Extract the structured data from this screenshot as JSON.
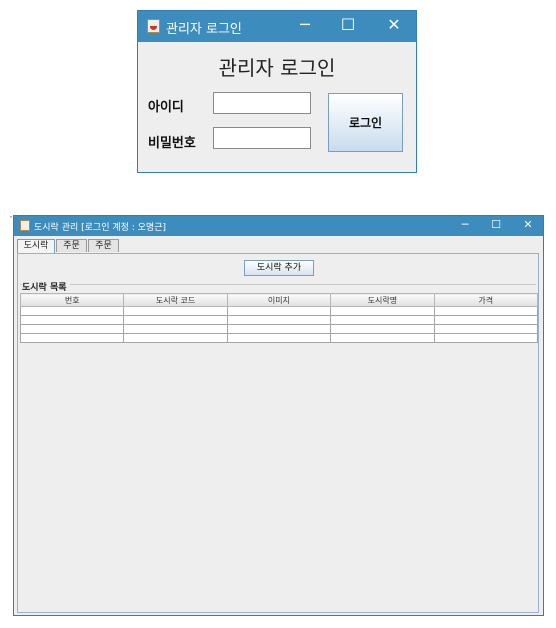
{
  "login_window": {
    "title": "관리자 로그인",
    "heading": "관리자 로그인",
    "id_label": "아이디",
    "password_label": "비밀번호",
    "id_value": "",
    "password_value": "",
    "login_button": "로그인",
    "controls": {
      "minimize": "─",
      "maximize": "☐",
      "close": "✕"
    }
  },
  "main_window": {
    "title": "도시락 관리 [로그인 계정 : 오명근]",
    "controls": {
      "minimize": "─",
      "maximize": "☐",
      "close": "✕"
    },
    "tabs": [
      {
        "label": "도시락",
        "active": true
      },
      {
        "label": "주문",
        "active": false
      },
      {
        "label": "주문",
        "active": false
      }
    ],
    "add_button": "도시락 추가",
    "list_title": "도시락 목록",
    "table": {
      "columns": [
        "번호",
        "도시락 코드",
        "이미지",
        "도시락명",
        "가격"
      ],
      "rows": [
        [
          "",
          "",
          "",
          "",
          ""
        ],
        [
          "",
          "",
          "",
          "",
          ""
        ],
        [
          "",
          "",
          "",
          "",
          ""
        ],
        [
          "",
          "",
          "",
          "",
          ""
        ]
      ]
    }
  },
  "colors": {
    "titlebar": "#3c8dbd",
    "window_bg": "#eeeeee",
    "button_gradient_end": "#c9dcee"
  }
}
